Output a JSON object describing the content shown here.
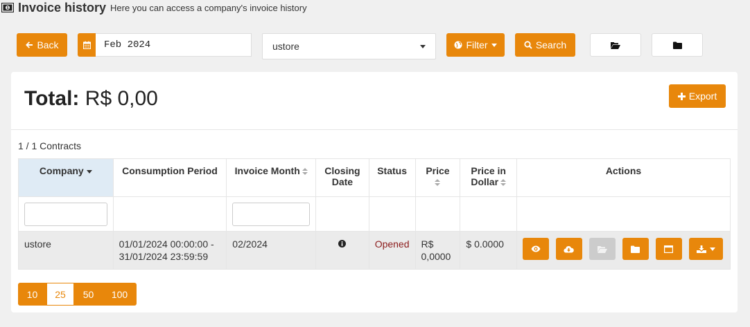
{
  "header": {
    "title": "Invoice history",
    "subtitle": "Here you can access a company's invoice history"
  },
  "toolbar": {
    "back_label": "Back",
    "month_value": "Feb 2024",
    "company_value": "ustore",
    "filter_label": "Filter",
    "search_label": "Search"
  },
  "summary": {
    "total_label": "Total:",
    "total_value": "R$ 0,00",
    "export_label": "Export",
    "contracts_count": "1 / 1 Contracts"
  },
  "table": {
    "columns": {
      "company": "Company",
      "consumption_period": "Consumption Period",
      "invoice_month": "Invoice Month",
      "closing_date_1": "Closing",
      "closing_date_2": "Date",
      "status": "Status",
      "price": "Price",
      "price_dollar_1": "Price in",
      "price_dollar_2": "Dollar",
      "actions": "Actions"
    },
    "rows": [
      {
        "company": "ustore",
        "period_start": "01/01/2024 00:00:00 -",
        "period_end": "31/01/2024 23:59:59",
        "invoice_month": "02/2024",
        "status": "Opened",
        "price_1": "R$",
        "price_2": "0,0000",
        "price_dollar": "$ 0.0000"
      }
    ]
  },
  "pagination": {
    "sizes": [
      "10",
      "25",
      "50",
      "100"
    ],
    "selected": "25"
  },
  "colors": {
    "accent": "#e8870b",
    "status_opened": "#8b1a1a",
    "sorted_header": "#dfebf5"
  }
}
